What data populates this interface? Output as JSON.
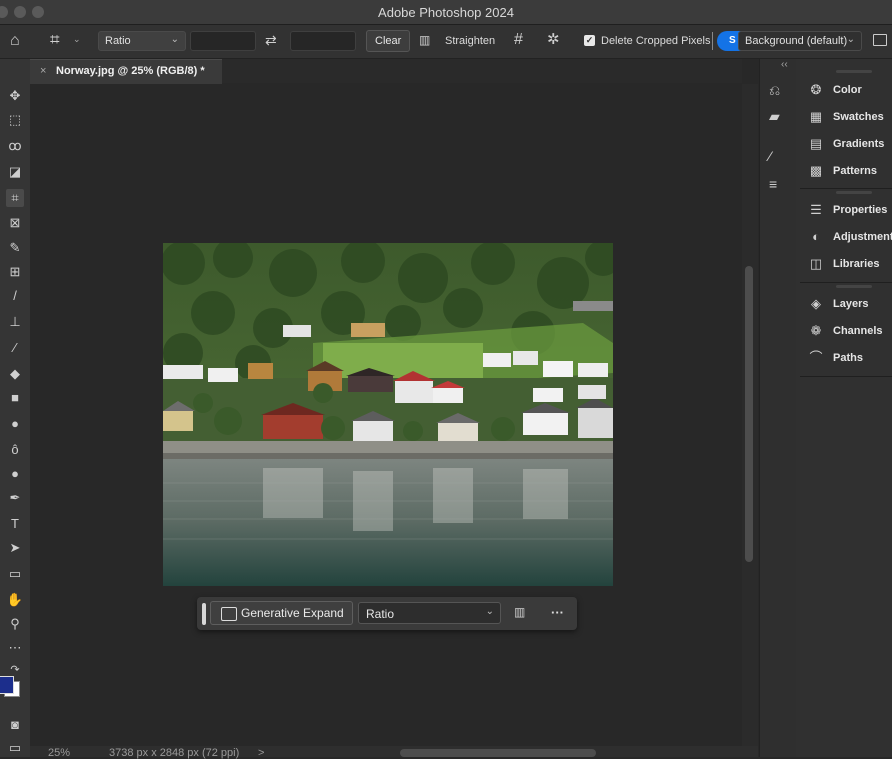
{
  "app": {
    "title": "Adobe Photoshop 2024"
  },
  "options_bar": {
    "ratio_label": "Ratio",
    "clear_label": "Clear",
    "straighten_label": "Straighten",
    "delete_cropped_label": "Delete Cropped Pixels",
    "delete_cropped_checked": true,
    "fill_label": "Background (default)",
    "swap_icon": "swap-icon",
    "grid_icon": "overlay-grid-icon",
    "settings_icon": "gear-icon"
  },
  "document": {
    "tab_label": "Norway.jpg @ 25% (RGB/8) *"
  },
  "contextual_bar": {
    "generate_label": "Generative Expand",
    "ratio_label": "Ratio",
    "more_label": "···"
  },
  "status": {
    "zoom": "25%",
    "doc_info": "3738 px x 2848 px (72 ppi)",
    "arrow": ">"
  },
  "panels": {
    "group1": [
      {
        "label": "Color",
        "icon": "color-palette-icon"
      },
      {
        "label": "Swatches",
        "icon": "swatches-icon"
      },
      {
        "label": "Gradients",
        "icon": "gradient-icon"
      },
      {
        "label": "Patterns",
        "icon": "patterns-icon"
      }
    ],
    "group2": [
      {
        "label": "Properties",
        "icon": "properties-icon"
      },
      {
        "label": "Adjustments",
        "icon": "adjustments-icon"
      },
      {
        "label": "Libraries",
        "icon": "libraries-icon"
      }
    ],
    "group3": [
      {
        "label": "Layers",
        "icon": "layers-icon"
      },
      {
        "label": "Channels",
        "icon": "channels-icon"
      },
      {
        "label": "Paths",
        "icon": "paths-icon"
      }
    ],
    "collapse_label": "‹‹"
  },
  "colors": {
    "foreground": "#1c2e8c",
    "background": "#ffffff",
    "accent": "#1473e6"
  }
}
